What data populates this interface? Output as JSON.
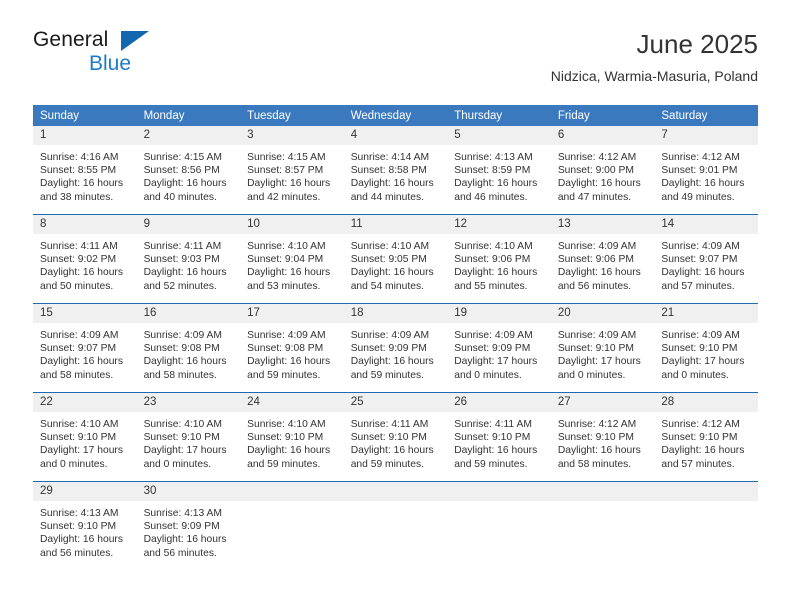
{
  "brand": {
    "name_top": "General",
    "name_bottom": "Blue",
    "accent_color": "#1e7bc8",
    "triangle_color": "#1267b0"
  },
  "header": {
    "title": "June 2025",
    "location": "Nidzica, Warmia-Masuria, Poland"
  },
  "theme": {
    "header_row_bg": "#3b79bf",
    "row_divider": "#1f6bb0",
    "daynum_bg": "#f0f0f0",
    "text": "#333333"
  },
  "weekdays": [
    "Sunday",
    "Monday",
    "Tuesday",
    "Wednesday",
    "Thursday",
    "Friday",
    "Saturday"
  ],
  "weeks": [
    [
      {
        "day": "1",
        "sunrise": "Sunrise: 4:16 AM",
        "sunset": "Sunset: 8:55 PM",
        "daylight1": "Daylight: 16 hours",
        "daylight2": "and 38 minutes."
      },
      {
        "day": "2",
        "sunrise": "Sunrise: 4:15 AM",
        "sunset": "Sunset: 8:56 PM",
        "daylight1": "Daylight: 16 hours",
        "daylight2": "and 40 minutes."
      },
      {
        "day": "3",
        "sunrise": "Sunrise: 4:15 AM",
        "sunset": "Sunset: 8:57 PM",
        "daylight1": "Daylight: 16 hours",
        "daylight2": "and 42 minutes."
      },
      {
        "day": "4",
        "sunrise": "Sunrise: 4:14 AM",
        "sunset": "Sunset: 8:58 PM",
        "daylight1": "Daylight: 16 hours",
        "daylight2": "and 44 minutes."
      },
      {
        "day": "5",
        "sunrise": "Sunrise: 4:13 AM",
        "sunset": "Sunset: 8:59 PM",
        "daylight1": "Daylight: 16 hours",
        "daylight2": "and 46 minutes."
      },
      {
        "day": "6",
        "sunrise": "Sunrise: 4:12 AM",
        "sunset": "Sunset: 9:00 PM",
        "daylight1": "Daylight: 16 hours",
        "daylight2": "and 47 minutes."
      },
      {
        "day": "7",
        "sunrise": "Sunrise: 4:12 AM",
        "sunset": "Sunset: 9:01 PM",
        "daylight1": "Daylight: 16 hours",
        "daylight2": "and 49 minutes."
      }
    ],
    [
      {
        "day": "8",
        "sunrise": "Sunrise: 4:11 AM",
        "sunset": "Sunset: 9:02 PM",
        "daylight1": "Daylight: 16 hours",
        "daylight2": "and 50 minutes."
      },
      {
        "day": "9",
        "sunrise": "Sunrise: 4:11 AM",
        "sunset": "Sunset: 9:03 PM",
        "daylight1": "Daylight: 16 hours",
        "daylight2": "and 52 minutes."
      },
      {
        "day": "10",
        "sunrise": "Sunrise: 4:10 AM",
        "sunset": "Sunset: 9:04 PM",
        "daylight1": "Daylight: 16 hours",
        "daylight2": "and 53 minutes."
      },
      {
        "day": "11",
        "sunrise": "Sunrise: 4:10 AM",
        "sunset": "Sunset: 9:05 PM",
        "daylight1": "Daylight: 16 hours",
        "daylight2": "and 54 minutes."
      },
      {
        "day": "12",
        "sunrise": "Sunrise: 4:10 AM",
        "sunset": "Sunset: 9:06 PM",
        "daylight1": "Daylight: 16 hours",
        "daylight2": "and 55 minutes."
      },
      {
        "day": "13",
        "sunrise": "Sunrise: 4:09 AM",
        "sunset": "Sunset: 9:06 PM",
        "daylight1": "Daylight: 16 hours",
        "daylight2": "and 56 minutes."
      },
      {
        "day": "14",
        "sunrise": "Sunrise: 4:09 AM",
        "sunset": "Sunset: 9:07 PM",
        "daylight1": "Daylight: 16 hours",
        "daylight2": "and 57 minutes."
      }
    ],
    [
      {
        "day": "15",
        "sunrise": "Sunrise: 4:09 AM",
        "sunset": "Sunset: 9:07 PM",
        "daylight1": "Daylight: 16 hours",
        "daylight2": "and 58 minutes."
      },
      {
        "day": "16",
        "sunrise": "Sunrise: 4:09 AM",
        "sunset": "Sunset: 9:08 PM",
        "daylight1": "Daylight: 16 hours",
        "daylight2": "and 58 minutes."
      },
      {
        "day": "17",
        "sunrise": "Sunrise: 4:09 AM",
        "sunset": "Sunset: 9:08 PM",
        "daylight1": "Daylight: 16 hours",
        "daylight2": "and 59 minutes."
      },
      {
        "day": "18",
        "sunrise": "Sunrise: 4:09 AM",
        "sunset": "Sunset: 9:09 PM",
        "daylight1": "Daylight: 16 hours",
        "daylight2": "and 59 minutes."
      },
      {
        "day": "19",
        "sunrise": "Sunrise: 4:09 AM",
        "sunset": "Sunset: 9:09 PM",
        "daylight1": "Daylight: 17 hours",
        "daylight2": "and 0 minutes."
      },
      {
        "day": "20",
        "sunrise": "Sunrise: 4:09 AM",
        "sunset": "Sunset: 9:10 PM",
        "daylight1": "Daylight: 17 hours",
        "daylight2": "and 0 minutes."
      },
      {
        "day": "21",
        "sunrise": "Sunrise: 4:09 AM",
        "sunset": "Sunset: 9:10 PM",
        "daylight1": "Daylight: 17 hours",
        "daylight2": "and 0 minutes."
      }
    ],
    [
      {
        "day": "22",
        "sunrise": "Sunrise: 4:10 AM",
        "sunset": "Sunset: 9:10 PM",
        "daylight1": "Daylight: 17 hours",
        "daylight2": "and 0 minutes."
      },
      {
        "day": "23",
        "sunrise": "Sunrise: 4:10 AM",
        "sunset": "Sunset: 9:10 PM",
        "daylight1": "Daylight: 17 hours",
        "daylight2": "and 0 minutes."
      },
      {
        "day": "24",
        "sunrise": "Sunrise: 4:10 AM",
        "sunset": "Sunset: 9:10 PM",
        "daylight1": "Daylight: 16 hours",
        "daylight2": "and 59 minutes."
      },
      {
        "day": "25",
        "sunrise": "Sunrise: 4:11 AM",
        "sunset": "Sunset: 9:10 PM",
        "daylight1": "Daylight: 16 hours",
        "daylight2": "and 59 minutes."
      },
      {
        "day": "26",
        "sunrise": "Sunrise: 4:11 AM",
        "sunset": "Sunset: 9:10 PM",
        "daylight1": "Daylight: 16 hours",
        "daylight2": "and 59 minutes."
      },
      {
        "day": "27",
        "sunrise": "Sunrise: 4:12 AM",
        "sunset": "Sunset: 9:10 PM",
        "daylight1": "Daylight: 16 hours",
        "daylight2": "and 58 minutes."
      },
      {
        "day": "28",
        "sunrise": "Sunrise: 4:12 AM",
        "sunset": "Sunset: 9:10 PM",
        "daylight1": "Daylight: 16 hours",
        "daylight2": "and 57 minutes."
      }
    ],
    [
      {
        "day": "29",
        "sunrise": "Sunrise: 4:13 AM",
        "sunset": "Sunset: 9:10 PM",
        "daylight1": "Daylight: 16 hours",
        "daylight2": "and 56 minutes."
      },
      {
        "day": "30",
        "sunrise": "Sunrise: 4:13 AM",
        "sunset": "Sunset: 9:09 PM",
        "daylight1": "Daylight: 16 hours",
        "daylight2": "and 56 minutes."
      },
      {
        "day": "",
        "sunrise": "",
        "sunset": "",
        "daylight1": "",
        "daylight2": ""
      },
      {
        "day": "",
        "sunrise": "",
        "sunset": "",
        "daylight1": "",
        "daylight2": ""
      },
      {
        "day": "",
        "sunrise": "",
        "sunset": "",
        "daylight1": "",
        "daylight2": ""
      },
      {
        "day": "",
        "sunrise": "",
        "sunset": "",
        "daylight1": "",
        "daylight2": ""
      },
      {
        "day": "",
        "sunrise": "",
        "sunset": "",
        "daylight1": "",
        "daylight2": ""
      }
    ]
  ]
}
